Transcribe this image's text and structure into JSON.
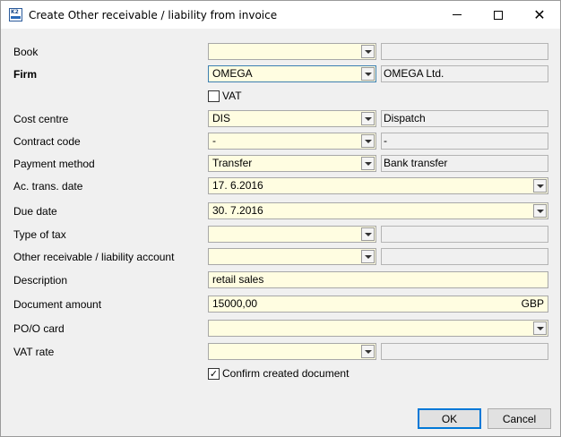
{
  "window": {
    "title": "Create Other receivable / liability from invoice",
    "app_icon_text": "K2"
  },
  "form": {
    "book": {
      "label": "Book",
      "value": "",
      "description": ""
    },
    "firm": {
      "label": "Firm",
      "value": "OMEGA",
      "description": "OMEGA Ltd."
    },
    "vat": {
      "label": "VAT",
      "checked": false
    },
    "cost_centre": {
      "label": "Cost centre",
      "value": "DIS",
      "description": "Dispatch"
    },
    "contract_code": {
      "label": "Contract code",
      "value": "-",
      "description": "-"
    },
    "payment_method": {
      "label": "Payment method",
      "value": "Transfer",
      "description": "Bank transfer"
    },
    "ac_trans_date": {
      "label": "Ac. trans. date",
      "value": "17. 6.2016"
    },
    "due_date": {
      "label": "Due date",
      "value": "30. 7.2016"
    },
    "type_of_tax": {
      "label": "Type of tax",
      "value": "",
      "description": ""
    },
    "account": {
      "label": "Other receivable / liability account",
      "value": "",
      "description": ""
    },
    "description": {
      "label": "Description",
      "value": "retail sales"
    },
    "document_amount": {
      "label": "Document amount",
      "value": "15000,00",
      "currency": "GBP"
    },
    "po_card": {
      "label": "PO/O card",
      "value": ""
    },
    "vat_rate": {
      "label": "VAT rate",
      "value": "",
      "description": ""
    },
    "confirm": {
      "label": "Confirm created document",
      "checked": true
    }
  },
  "buttons": {
    "ok": "OK",
    "cancel": "Cancel"
  },
  "colors": {
    "field_bg": "#fffde1",
    "readonly_bg": "#f0f0f0",
    "default_button_border": "#0078d7"
  }
}
